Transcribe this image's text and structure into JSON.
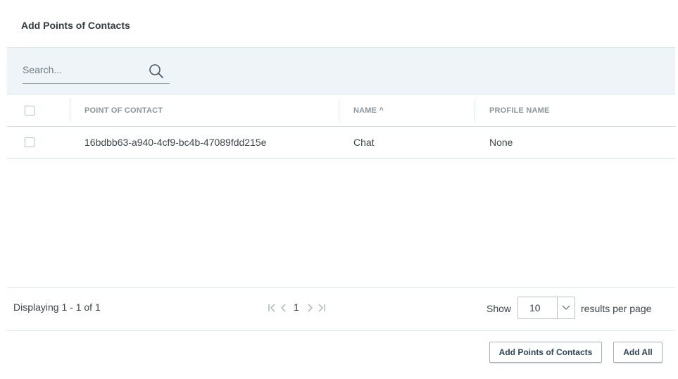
{
  "dialog": {
    "title": "Add Points of Contacts"
  },
  "search": {
    "placeholder": "Search..."
  },
  "table": {
    "columns": [
      "POINT OF CONTACT",
      "NAME ^",
      "PROFILE NAME"
    ],
    "rows": [
      {
        "point_of_contact": "16bdbb63-a940-4cf9-bc4b-47089fdd215e",
        "name": "Chat",
        "profile_name": "None"
      }
    ]
  },
  "pagination": {
    "displaying": "Displaying 1 - 1 of 1",
    "current_page": "1",
    "show_label": "Show",
    "page_size": "10",
    "results_label": "results per page"
  },
  "buttons": {
    "add_contacts": "Add Points of Contacts",
    "add_all": "Add All"
  },
  "colors": {
    "search_bar_bg": "#eef4f7",
    "header_text": "#8a949b",
    "button_text": "#2f4558"
  },
  "icons": [
    "search-icon",
    "first-page-icon",
    "prev-page-icon",
    "next-page-icon",
    "last-page-icon",
    "chevron-down-icon"
  ]
}
